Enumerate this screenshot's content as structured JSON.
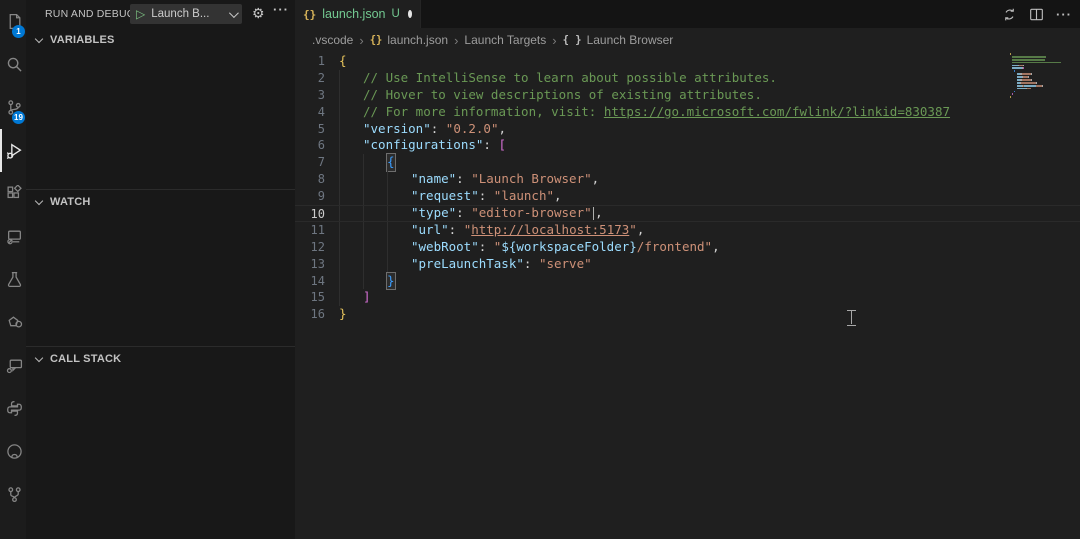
{
  "activity_bar": {
    "badge_color": "#0078d4",
    "items": [
      {
        "id": "explorer",
        "badge": "1"
      },
      {
        "id": "search"
      },
      {
        "id": "source-control",
        "badge": "19"
      },
      {
        "id": "run-and-debug",
        "active": true
      },
      {
        "id": "extensions"
      },
      {
        "id": "remote-explorer"
      },
      {
        "id": "testing"
      },
      {
        "id": "custom-extension"
      },
      {
        "id": "comments"
      },
      {
        "id": "python"
      },
      {
        "id": "github"
      },
      {
        "id": "git-pull-requests"
      }
    ]
  },
  "sidebar": {
    "title": "RUN AND DEBUG",
    "launch_button": {
      "label": "Launch B...",
      "play_glyph": "▷"
    },
    "gear_glyph": "⚙",
    "more_glyph": "···",
    "sections": [
      {
        "label": "VARIABLES"
      },
      {
        "label": "WATCH"
      },
      {
        "label": "CALL STACK"
      }
    ]
  },
  "editor": {
    "tab": {
      "icon": "{}",
      "label": "launch.json",
      "git_status": "U",
      "dirty": true
    },
    "actions_more_glyph": "···",
    "breadcrumb": {
      "sep": "›",
      "items": [
        ".vscode",
        "launch.json",
        "Launch Targets",
        "Launch Browser"
      ]
    },
    "active_line": 10,
    "lines": [
      {
        "ind": 0,
        "toks": [
          {
            "t": "{",
            "c": "b1"
          }
        ]
      },
      {
        "ind": 1,
        "toks": [
          {
            "t": "// Use IntelliSense to learn about possible attributes.",
            "c": "cmt"
          }
        ]
      },
      {
        "ind": 1,
        "toks": [
          {
            "t": "// Hover to view descriptions of existing attributes.",
            "c": "cmt"
          }
        ]
      },
      {
        "ind": 1,
        "toks": [
          {
            "t": "// For more information, visit: ",
            "c": "cmt"
          },
          {
            "t": "https://go.microsoft.com/fwlink/?linkid=830387",
            "c": "cmt u"
          }
        ]
      },
      {
        "ind": 1,
        "toks": [
          {
            "t": "\"version\"",
            "c": "key"
          },
          {
            "t": ": ",
            "c": "pn"
          },
          {
            "t": "\"0.2.0\"",
            "c": "str"
          },
          {
            "t": ",",
            "c": "pn"
          }
        ]
      },
      {
        "ind": 1,
        "toks": [
          {
            "t": "\"configurations\"",
            "c": "key"
          },
          {
            "t": ": ",
            "c": "pn"
          },
          {
            "t": "[",
            "c": "b2"
          }
        ]
      },
      {
        "ind": 2,
        "toks": [
          {
            "t": "{",
            "c": "b3 box"
          }
        ]
      },
      {
        "ind": 3,
        "toks": [
          {
            "t": "\"name\"",
            "c": "key"
          },
          {
            "t": ": ",
            "c": "pn"
          },
          {
            "t": "\"Launch Browser\"",
            "c": "str"
          },
          {
            "t": ",",
            "c": "pn"
          }
        ]
      },
      {
        "ind": 3,
        "toks": [
          {
            "t": "\"request\"",
            "c": "key"
          },
          {
            "t": ": ",
            "c": "pn"
          },
          {
            "t": "\"launch\"",
            "c": "str"
          },
          {
            "t": ",",
            "c": "pn"
          }
        ]
      },
      {
        "ind": 3,
        "toks": [
          {
            "t": "\"type\"",
            "c": "key"
          },
          {
            "t": ": ",
            "c": "pn"
          },
          {
            "t": "\"editor-browser\"",
            "c": "str"
          },
          {
            "caret": true
          },
          {
            "t": ",",
            "c": "pn"
          }
        ]
      },
      {
        "ind": 3,
        "toks": [
          {
            "t": "\"url\"",
            "c": "key"
          },
          {
            "t": ": ",
            "c": "pn"
          },
          {
            "t": "\"",
            "c": "str"
          },
          {
            "t": "http://localhost:5173",
            "c": "str u"
          },
          {
            "t": "\"",
            "c": "str"
          },
          {
            "t": ",",
            "c": "pn"
          }
        ]
      },
      {
        "ind": 3,
        "toks": [
          {
            "t": "\"webRoot\"",
            "c": "key"
          },
          {
            "t": ": ",
            "c": "pn"
          },
          {
            "t": "\"",
            "c": "str"
          },
          {
            "t": "${workspaceFolder}",
            "c": "var"
          },
          {
            "t": "/frontend",
            "c": "str"
          },
          {
            "t": "\"",
            "c": "str"
          },
          {
            "t": ",",
            "c": "pn"
          }
        ]
      },
      {
        "ind": 3,
        "toks": [
          {
            "t": "\"preLaunchTask\"",
            "c": "key"
          },
          {
            "t": ": ",
            "c": "pn"
          },
          {
            "t": "\"serve\"",
            "c": "str"
          }
        ]
      },
      {
        "ind": 2,
        "toks": [
          {
            "t": "}",
            "c": "b3 box"
          }
        ]
      },
      {
        "ind": 1,
        "toks": [
          {
            "t": "]",
            "c": "b2"
          }
        ]
      },
      {
        "ind": 0,
        "toks": [
          {
            "t": "}",
            "c": "b1"
          }
        ]
      }
    ],
    "token_colors": {
      "key": "#9cdcfe",
      "str": "#ce9178",
      "cmt": "#6a9955",
      "pn": "#d4d4d4",
      "var": "#9cdcfe",
      "b1": "#e6c35c",
      "b2": "#d670d6",
      "b3": "#3b9eff"
    }
  }
}
